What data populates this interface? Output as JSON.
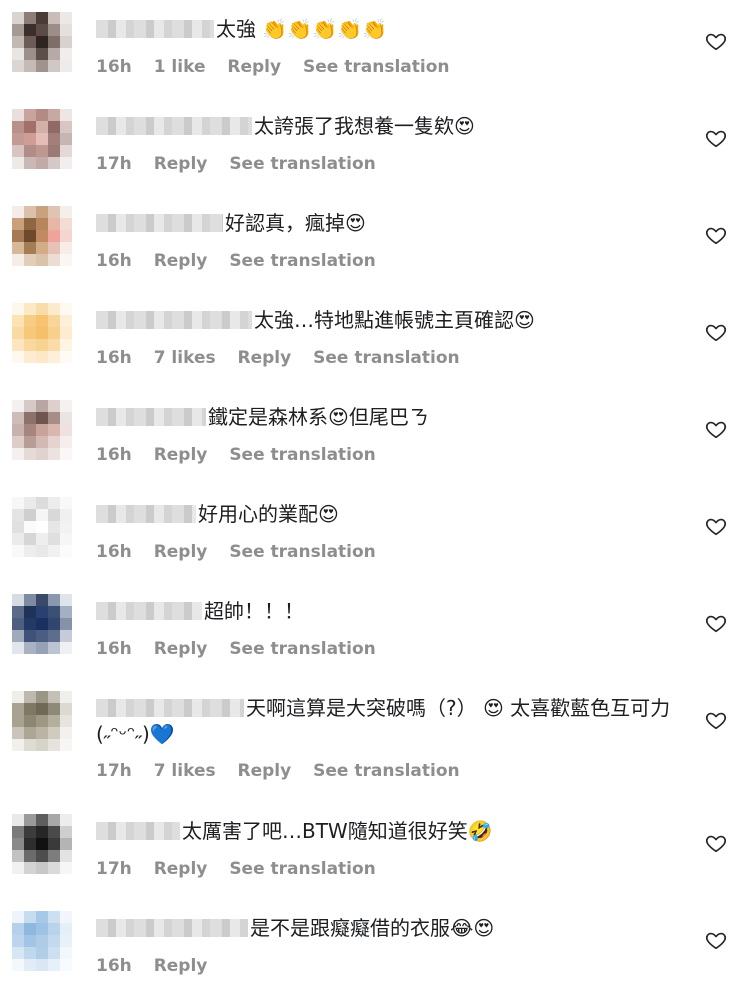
{
  "comments": [
    {
      "text": "太強 👏👏👏👏👏",
      "time": "16h",
      "likes": "1 like",
      "reply": "Reply",
      "translate": "See translation",
      "avatar": [
        "#d9d4d1",
        "#8c7d77",
        "#4a3b36",
        "#c8bdb8",
        "#ece8e6",
        "#a69a95",
        "#3a2f2c",
        "#5d4b45",
        "#9b8d88",
        "#e5e0de",
        "#c3b9b4",
        "#6d5c56",
        "#2e2523",
        "#7e6e68",
        "#d8d1cd",
        "#e9e5e3",
        "#9d8f8a",
        "#5e4e49",
        "#b5aaa5",
        "#f0eded",
        "#dcd6d3",
        "#c4bab6",
        "#a0928d",
        "#d0c8c4",
        "#eeebea"
      ]
    },
    {
      "text": "太誇張了我想養一隻欸😍",
      "time": "17h",
      "likes": "",
      "reply": "Reply",
      "translate": "See translation",
      "avatar": [
        "#eadfdc",
        "#c9a39d",
        "#b48a84",
        "#c7a8a2",
        "#eee6e4",
        "#b9918b",
        "#a27069",
        "#d2b0aa",
        "#8f6a66",
        "#d9c6c2",
        "#c49b94",
        "#cf9d96",
        "#e3bdb6",
        "#a47e78",
        "#c6b6b3",
        "#d7c5c2",
        "#b28d88",
        "#bf9791",
        "#9b7974",
        "#e3d8d6",
        "#eee8e7",
        "#c9b8b5",
        "#c2aba7",
        "#d5c9c7",
        "#f1eeed"
      ]
    },
    {
      "text": "好認真，瘋掉😍",
      "time": "16h",
      "likes": "",
      "reply": "Reply",
      "translate": "See translation",
      "avatar": [
        "#f3ece7",
        "#d9c1ab",
        "#c8a27d",
        "#dec5b3",
        "#f5efeb",
        "#c9a07a",
        "#8e6641",
        "#b7855c",
        "#e8b6a5",
        "#f2dcd4",
        "#a67a55",
        "#6e4a2d",
        "#c28a62",
        "#f0a39a",
        "#f7d5cf",
        "#d8b89a",
        "#a57d55",
        "#d3ab89",
        "#e5c2b5",
        "#f8ece8",
        "#f4ede8",
        "#e2cdb8",
        "#dbc3ab",
        "#ecdcd2",
        "#faf6f3"
      ]
    },
    {
      "text": "太強…特地點進帳號主頁確認😍",
      "time": "16h",
      "likes": "7 likes",
      "reply": "Reply",
      "translate": "See translation",
      "avatar": [
        "#fdf7ec",
        "#fbe8c4",
        "#f9dca8",
        "#fbeacb",
        "#fef9f1",
        "#fbe3b3",
        "#f8cd83",
        "#f6c471",
        "#f9d597",
        "#fdf0d8",
        "#fad9a2",
        "#f7c87a",
        "#f5c06a",
        "#f8cf8b",
        "#fdecd0",
        "#fce6c0",
        "#f9d79f",
        "#f8d291",
        "#fadcaa",
        "#fef4e3",
        "#fef8ef",
        "#fdecd2",
        "#fce7c6",
        "#fdefd9",
        "#fffaf3"
      ]
    },
    {
      "text": "鐵定是森林系😍但尾巴ㄋ",
      "time": "16h",
      "likes": "",
      "reply": "Reply",
      "translate": "See translation",
      "avatar": [
        "#f4f0ef",
        "#d6c9c6",
        "#b9a6a2",
        "#dccfcc",
        "#f5f1f0",
        "#cdbcb8",
        "#8d726c",
        "#6e5550",
        "#a68d87",
        "#ece4e2",
        "#c9b2ad",
        "#a7857e",
        "#c7a39b",
        "#d9b6ae",
        "#efe1de",
        "#ddccc8",
        "#b89d97",
        "#d2b9b3",
        "#e6d3cf",
        "#f6eeec",
        "#f5f0ef",
        "#e5dad7",
        "#dfd2cf",
        "#ece3e1",
        "#faf7f6"
      ]
    },
    {
      "text": "好用心的業配😍",
      "time": "16h",
      "likes": "",
      "reply": "Reply",
      "translate": "See translation",
      "avatar": [
        "#f7f7f7",
        "#eaeaea",
        "#dcdcdc",
        "#ececec",
        "#f8f8f8",
        "#e4e4e4",
        "#cfcfcf",
        "#f5f5f5",
        "#d8d8d8",
        "#f0f0f0",
        "#e0e0e0",
        "#fafafa",
        "#ffffff",
        "#e6e6e6",
        "#f2f2f2",
        "#ebebeb",
        "#d6d6d6",
        "#eeeeee",
        "#dfdfdf",
        "#f6f6f6",
        "#f9f9f9",
        "#ededed",
        "#e8e8e8",
        "#f1f1f1",
        "#fbfbfb"
      ]
    },
    {
      "text": "超帥！！！",
      "time": "16h",
      "likes": "",
      "reply": "Reply",
      "translate": "See translation",
      "avatar": [
        "#d6dbe4",
        "#7f8ba1",
        "#3a4a68",
        "#8a97ae",
        "#dfe3ea",
        "#5a6a88",
        "#1f3358",
        "#2a4070",
        "#3c4f74",
        "#a3afc3",
        "#4d5e80",
        "#233a66",
        "#1a3160",
        "#31466e",
        "#8592aa",
        "#a0aabd",
        "#3f5279",
        "#4b5d82",
        "#5c6d8e",
        "#c5ccd8",
        "#e2e5eb",
        "#a9b2c3",
        "#96a1b6",
        "#bcc4d2",
        "#eef0f4"
      ]
    },
    {
      "text": "天啊這算是大突破嗎（?） 😍 太喜歡藍色互可力 (˶ᵔᵕᵔ˶)💙",
      "time": "17h",
      "likes": "7 likes",
      "reply": "Reply",
      "translate": "See translation",
      "avatar": [
        "#eeedea",
        "#bdb9ae",
        "#9a9585",
        "#c4c0b6",
        "#f0efec",
        "#a7a291",
        "#7e7865",
        "#6f6a58",
        "#8f8a77",
        "#dcd9d1",
        "#a8a390",
        "#8c8672",
        "#9d9784",
        "#b4ae9c",
        "#e7e4dd",
        "#c9c5ba",
        "#aca795",
        "#b9b4a3",
        "#cfcbbf",
        "#f2f1ed",
        "#f1f0ed",
        "#dedbd3",
        "#d6d3c9",
        "#e5e3dc",
        "#f7f6f4"
      ]
    },
    {
      "text": "太厲害了吧…BTW隨知道很好笑🤣",
      "time": "17h",
      "likes": "",
      "reply": "Reply",
      "translate": "See translation",
      "avatar": [
        "#e9e9e9",
        "#9a9a9a",
        "#5e5e5e",
        "#a8a8a8",
        "#ededed",
        "#7b7b7b",
        "#3c3c3c",
        "#262626",
        "#4a4a4a",
        "#cfcfcf",
        "#8a8a8a",
        "#2e2e2e",
        "#111111",
        "#3a3a3a",
        "#b4b4b4",
        "#c2c2c2",
        "#6b6b6b",
        "#4e4e4e",
        "#7d7d7d",
        "#e3e3e3",
        "#f1f1f1",
        "#d3d3d3",
        "#c8c8c8",
        "#dadada",
        "#f6f6f6"
      ]
    },
    {
      "text": "是不是跟癡癡借的衣服😂😍",
      "time": "16h",
      "likes": "",
      "reply": "Reply",
      "translate": "",
      "avatar": [
        "#eef4fa",
        "#c6dcef",
        "#a7c8e6",
        "#cde0f1",
        "#f0f6fb",
        "#b4d0ea",
        "#8fb8de",
        "#9ec2e3",
        "#b9d3eb",
        "#e5eff8",
        "#bcd5ec",
        "#a2c5e5",
        "#aecce8",
        "#c3daee",
        "#e8f1f9",
        "#d7e6f4",
        "#c0d8ed",
        "#b1cee9",
        "#cde0f1",
        "#f2f7fc",
        "#f3f8fc",
        "#e1ecf6",
        "#d9e7f4",
        "#e6f0f8",
        "#f8fbfd"
      ]
    }
  ]
}
